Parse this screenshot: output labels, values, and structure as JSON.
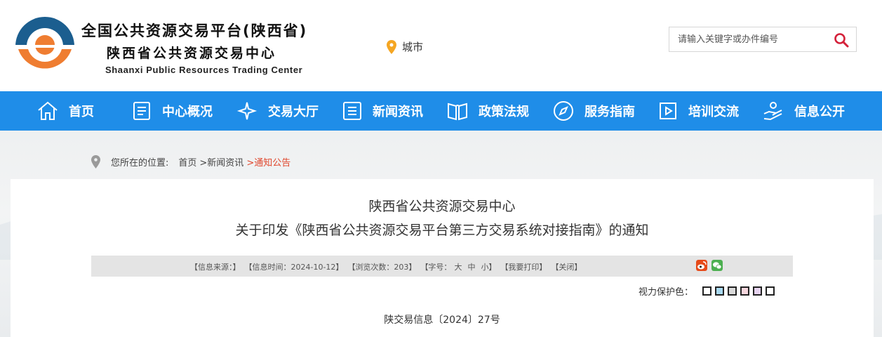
{
  "header": {
    "title_line1": "全国公共资源交易平台(陕西省)",
    "title_line2": "陕西省公共资源交易中心",
    "title_en": "Shaanxi Public Resources Trading Center",
    "city_label": "城市",
    "search_placeholder": "请输入关键字或办件编号"
  },
  "nav": {
    "items": [
      {
        "label": "首页",
        "icon": "home-icon"
      },
      {
        "label": "中心概况",
        "icon": "document-icon"
      },
      {
        "label": "交易大厅",
        "icon": "sparkle-icon"
      },
      {
        "label": "新闻资讯",
        "icon": "list-icon"
      },
      {
        "label": "政策法规",
        "icon": "book-icon"
      },
      {
        "label": "服务指南",
        "icon": "compass-icon"
      },
      {
        "label": "培训交流",
        "icon": "video-icon"
      },
      {
        "label": "信息公开",
        "icon": "hand-icon"
      }
    ]
  },
  "breadcrumb": {
    "prefix": "您所在的位置:",
    "home": "首页",
    "section": ">新闻资讯",
    "current": ">通知公告"
  },
  "article": {
    "title_line1": "陕西省公共资源交易中心",
    "title_line2": "关于印发《陕西省公共资源交易平台第三方交易系统对接指南》的通知",
    "info_source": "【信息来源：】",
    "info_time": "【信息时间：2024-10-12】",
    "info_views": "【浏览次数：203】",
    "font_size_label": "【字号：",
    "font_large": "大",
    "font_medium": "中",
    "font_small": "小】",
    "print": "【我要打印】",
    "close": "【关闭】",
    "eye_label": "视力保护色：",
    "doc_number": "陕交易信息〔2024〕27号"
  },
  "colors": {
    "nav_bg": "#1f8de8",
    "accent_red": "#e0472d",
    "logo_blue": "#1b5e8f",
    "logo_orange": "#ef7d31",
    "swatches": [
      "#ffffff",
      "#a9d9f0",
      "#d9d9d9",
      "#f4d5dc",
      "#e6d3ef",
      "#ffffff"
    ]
  }
}
